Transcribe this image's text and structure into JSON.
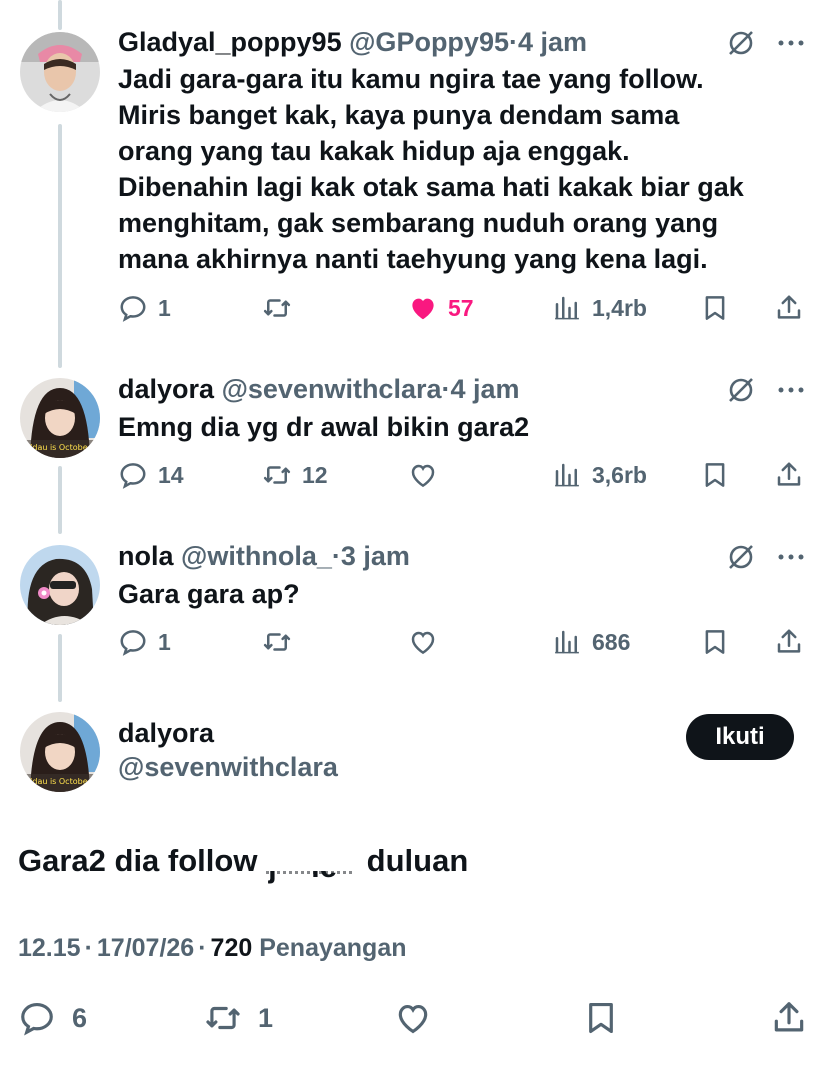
{
  "replies": [
    {
      "name": "Gladyal_poppy95",
      "handle": "@GPoppy95",
      "sep": "·",
      "time": "4 jam",
      "text": [
        "Jadi gara-gara itu kamu ngira tae yang follow.",
        "Miris banget kak, kaya punya dendam sama",
        "orang yang tau kakak hidup aja enggak.",
        "Dibenahin lagi kak otak sama hati kakak biar gak",
        "menghitam, gak sembarang nuduh orang yang",
        "mana akhirnya nanti taehyung yang kena lagi."
      ],
      "replies_count": "1",
      "retweets_count": "",
      "likes_count": "57",
      "views_count": "1,4rb",
      "liked": true
    },
    {
      "name": "dalyora",
      "handle": "@sevenwithclara",
      "sep": "·",
      "time": "4 jam",
      "text": [
        "Emng dia yg dr awal bikin gara2"
      ],
      "replies_count": "14",
      "retweets_count": "12",
      "likes_count": "",
      "views_count": "3,6rb",
      "liked": false
    },
    {
      "name": "nola",
      "handle": "@withnola_",
      "sep": "·",
      "time": "3 jam",
      "text": [
        "Gara gara ap?"
      ],
      "replies_count": "1",
      "retweets_count": "",
      "likes_count": "",
      "views_count": "686",
      "liked": false
    }
  ],
  "main_tweet": {
    "name": "dalyora",
    "handle": "@sevenwithclara",
    "follow_label": "Ikuti",
    "text_before": "Gara2 dia follow ",
    "text_partial": "j    ie",
    "text_after": " duluan",
    "time": "12.15",
    "date": "17/07/26",
    "sep": "·",
    "views": "720",
    "views_label": "Penayangan",
    "replies_count": "6",
    "retweets_count": "1",
    "likes_count": ""
  },
  "colors": {
    "text": "#0f1419",
    "secondary": "#536471",
    "like": "#f91880",
    "thread_line": "#cfd9de"
  }
}
